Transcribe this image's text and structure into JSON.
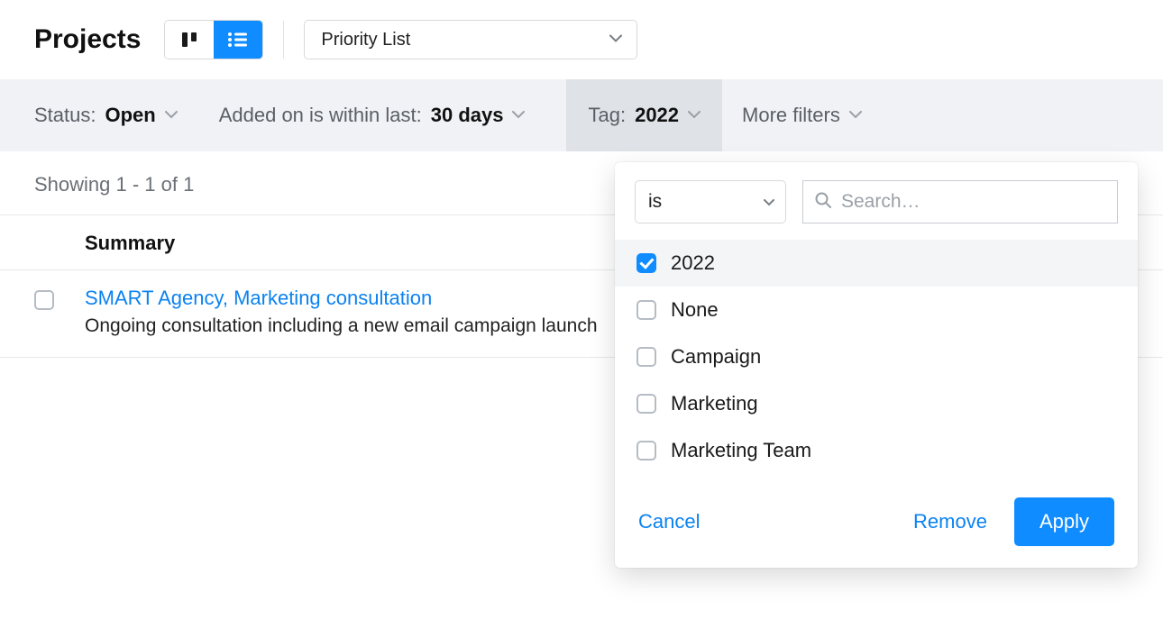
{
  "header": {
    "title": "Projects",
    "list_select": "Priority List"
  },
  "filters": {
    "status": {
      "label": "Status:",
      "value": "Open"
    },
    "added": {
      "label": "Added on is within last:",
      "value": "30 days"
    },
    "tag": {
      "label": "Tag:",
      "value": "2022"
    },
    "more": {
      "label": "More filters"
    }
  },
  "results": {
    "meta": "Showing 1 - 1 of 1",
    "columns": {
      "summary": "Summary"
    },
    "rows": [
      {
        "title": "SMART Agency, Marketing consultation",
        "description": "Ongoing consultation including a new email campaign launch"
      }
    ]
  },
  "tag_dropdown": {
    "condition": "is",
    "search_placeholder": "Search…",
    "options": [
      {
        "label": "2022",
        "checked": true
      },
      {
        "label": "None",
        "checked": false
      },
      {
        "label": "Campaign",
        "checked": false
      },
      {
        "label": "Marketing",
        "checked": false
      },
      {
        "label": "Marketing Team",
        "checked": false
      }
    ],
    "actions": {
      "cancel": "Cancel",
      "remove": "Remove",
      "apply": "Apply"
    }
  },
  "colors": {
    "accent": "#0f8cff",
    "link": "#0b82f0"
  }
}
